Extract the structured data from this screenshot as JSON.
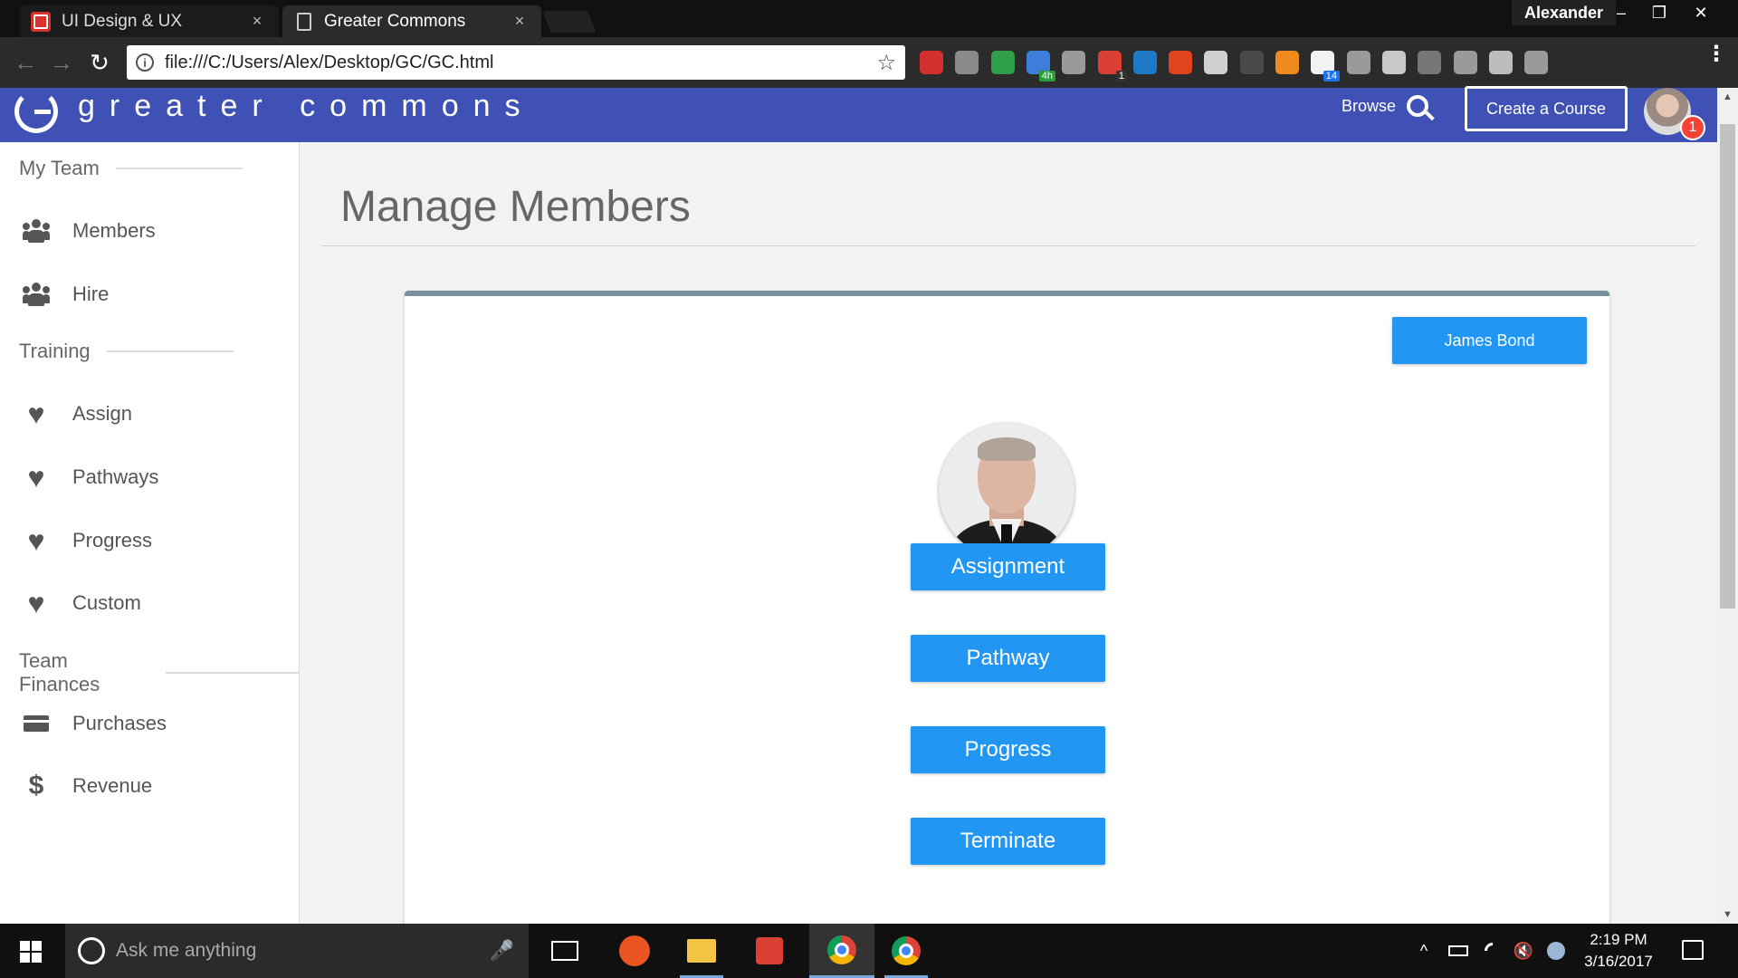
{
  "browser": {
    "tabs": [
      {
        "title": "UI Design & UX",
        "icon": "red-app-icon",
        "active": false
      },
      {
        "title": "Greater Commons",
        "icon": "document-icon",
        "active": true
      }
    ],
    "tab_close_glyph": "×",
    "profile_name": "Alexander",
    "window_controls": {
      "minimize": "–",
      "restore": "❐",
      "close": "✕"
    },
    "nav": {
      "back": "←",
      "forward": "→",
      "reload": "↻"
    },
    "url": "file:///C:/Users/Alex/Desktop/GC/GC.html",
    "info_glyph": "i",
    "bookmark_glyph": "☆",
    "extensions": [
      {
        "name": "adblock-icon",
        "color": "#d32f2f",
        "badge": ""
      },
      {
        "name": "ghost-icon",
        "color": "#8a8a8a",
        "badge": ""
      },
      {
        "name": "pushbullet-icon",
        "color": "#2e9e4a",
        "badge": ""
      },
      {
        "name": "calendar-icon",
        "color": "#3d7edb",
        "badge": "4h"
      },
      {
        "name": "bulb-icon",
        "color": "#9a9a9a",
        "badge": ""
      },
      {
        "name": "todoist-icon",
        "color": "#db4035",
        "badge": "1"
      },
      {
        "name": "trello-icon",
        "color": "#1e7ac6",
        "badge": ""
      },
      {
        "name": "bookmark-star-icon",
        "color": "#e0441e",
        "badge": ""
      },
      {
        "name": "spy-icon",
        "color": "#d0d0d0",
        "badge": ""
      },
      {
        "name": "screen-icon",
        "color": "#4a4a4a",
        "badge": ""
      },
      {
        "name": "play-icon",
        "color": "#f08a1c",
        "badge": ""
      },
      {
        "name": "chat-icon",
        "color": "#f2f2f2",
        "badge": "14"
      },
      {
        "name": "script-icon",
        "color": "#9a9a9a",
        "badge": ""
      },
      {
        "name": "toolbox-icon",
        "color": "#c8c8c8",
        "badge": ""
      },
      {
        "name": "cast-icon",
        "color": "#777777",
        "badge": ""
      },
      {
        "name": "jb-icon",
        "color": "#9a9a9a",
        "badge": ""
      },
      {
        "name": "drive-icon",
        "color": "#bdbdbd",
        "badge": ""
      },
      {
        "name": "css-icon",
        "color": "#9a9a9a",
        "badge": ""
      }
    ],
    "menu_glyph": "⋮"
  },
  "header": {
    "logo_text": "greater commons",
    "browse_label": "Browse",
    "create_course_label": "Create a Course",
    "notification_count": "1",
    "brand_color": "#3f51b5"
  },
  "sidebar": {
    "sections": [
      {
        "title": "My Team",
        "items": [
          {
            "label": "Members",
            "icon": "people-icon"
          },
          {
            "label": "Hire",
            "icon": "people-icon"
          }
        ]
      },
      {
        "title": "Training",
        "items": [
          {
            "label": "Assign",
            "icon": "heart-icon"
          },
          {
            "label": "Pathways",
            "icon": "heart-icon"
          },
          {
            "label": "Progress",
            "icon": "heart-icon"
          },
          {
            "label": "Custom",
            "icon": "heart-icon"
          }
        ]
      },
      {
        "title": "Team Finances",
        "items": [
          {
            "label": "Purchases",
            "icon": "credit-card-icon"
          },
          {
            "label": "Revenue",
            "icon": "dollar-icon"
          }
        ]
      }
    ],
    "glyphs": {
      "heart": "♥",
      "dollar": "$"
    }
  },
  "main": {
    "page_title": "Manage Members",
    "member_name": "James Bond",
    "actions": [
      "Assignment",
      "Pathway",
      "Progress",
      "Terminate"
    ],
    "accent_color": "#2196f3",
    "card_border_color": "#78909c"
  },
  "scrollbar": {
    "up": "▲",
    "down": "▼"
  },
  "taskbar": {
    "search_placeholder": "Ask me anything",
    "mic_glyph": "🎤",
    "apps": [
      "ubuntu-icon",
      "file-explorer-icon",
      "todoist-icon",
      "chrome-icon",
      "chrome-icon"
    ],
    "tray_chevron": "^",
    "volume_glyph": "🔇",
    "time": "2:19 PM",
    "date": "3/16/2017"
  }
}
